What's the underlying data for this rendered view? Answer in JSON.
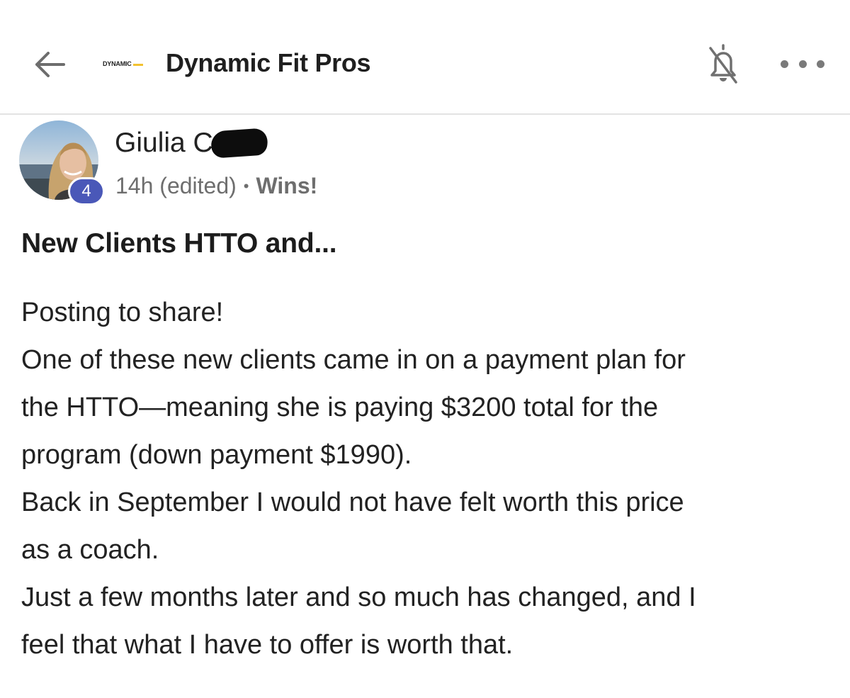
{
  "header": {
    "logo_text": "DYNAMIC",
    "title": "Dynamic Fit Pros",
    "back_icon": "arrow-left-icon",
    "bell_icon": "bell-off-icon",
    "more_icon": "more-horizontal-icon"
  },
  "post": {
    "author": {
      "name": "Giulia Co",
      "level": "4"
    },
    "meta": {
      "time": "14h (edited)",
      "separator": "•",
      "category": "Wins!"
    },
    "title": "New Clients HTTO and...",
    "body_lines": [
      "Posting to share!",
      "One of these new clients came in on a payment plan for",
      "the HTTO—meaning she is paying $3200 total for the",
      "program (down payment $1990).",
      "Back in September I would not have felt worth this price",
      "as a coach.",
      "Just a few months later and so much has changed, and I",
      "feel that what I have to offer is worth that."
    ]
  },
  "colors": {
    "level_badge": "#4a58b8",
    "logo_accent": "#f2c230",
    "divider": "#e3e3e3"
  }
}
